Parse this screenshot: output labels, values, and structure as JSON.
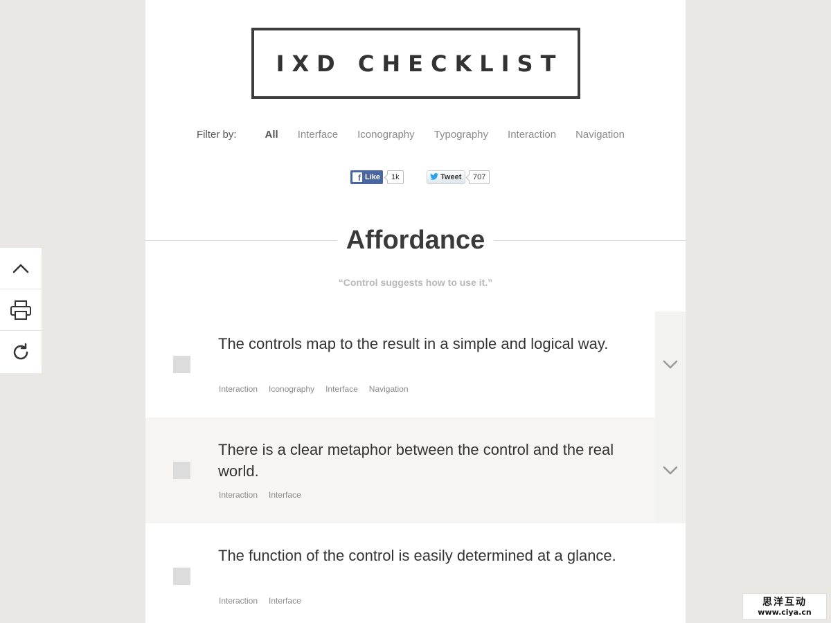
{
  "logo": {
    "text": "IXD CHECKLIST"
  },
  "filter": {
    "label": "Filter by:",
    "items": [
      "All",
      "Interface",
      "Iconography",
      "Typography",
      "Interaction",
      "Navigation"
    ],
    "active": "All"
  },
  "social": {
    "like_label": "Like",
    "like_count": "1k",
    "tweet_label": "Tweet",
    "tweet_count": "707"
  },
  "section": {
    "title": "Affordance",
    "quote": "“Control suggests how to use it.”"
  },
  "items": [
    {
      "text": "The controls map to the result in a simple and logical way.",
      "tags": [
        "Interaction",
        "Iconography",
        "Interface",
        "Navigation"
      ]
    },
    {
      "text": "There is a clear metaphor between the control and the real world.",
      "tags": [
        "Interaction",
        "Interface"
      ]
    },
    {
      "text": "The function of the control is easily determined at a glance.",
      "tags": [
        "Interaction",
        "Interface"
      ]
    }
  ],
  "sidebar": {
    "tools": [
      "scroll-up-icon",
      "print-icon",
      "reset-icon"
    ]
  },
  "watermark": {
    "line1": "思洋互动",
    "line2": "www.ciya.cn"
  },
  "colors": {
    "background": "#e9e8e4",
    "page": "#ffffff",
    "text": "#333333",
    "muted": "#8a8a8a",
    "checkbox": "#dcdcdc",
    "facebook": "#4a66a0",
    "twitter": "#2aa3ef"
  }
}
